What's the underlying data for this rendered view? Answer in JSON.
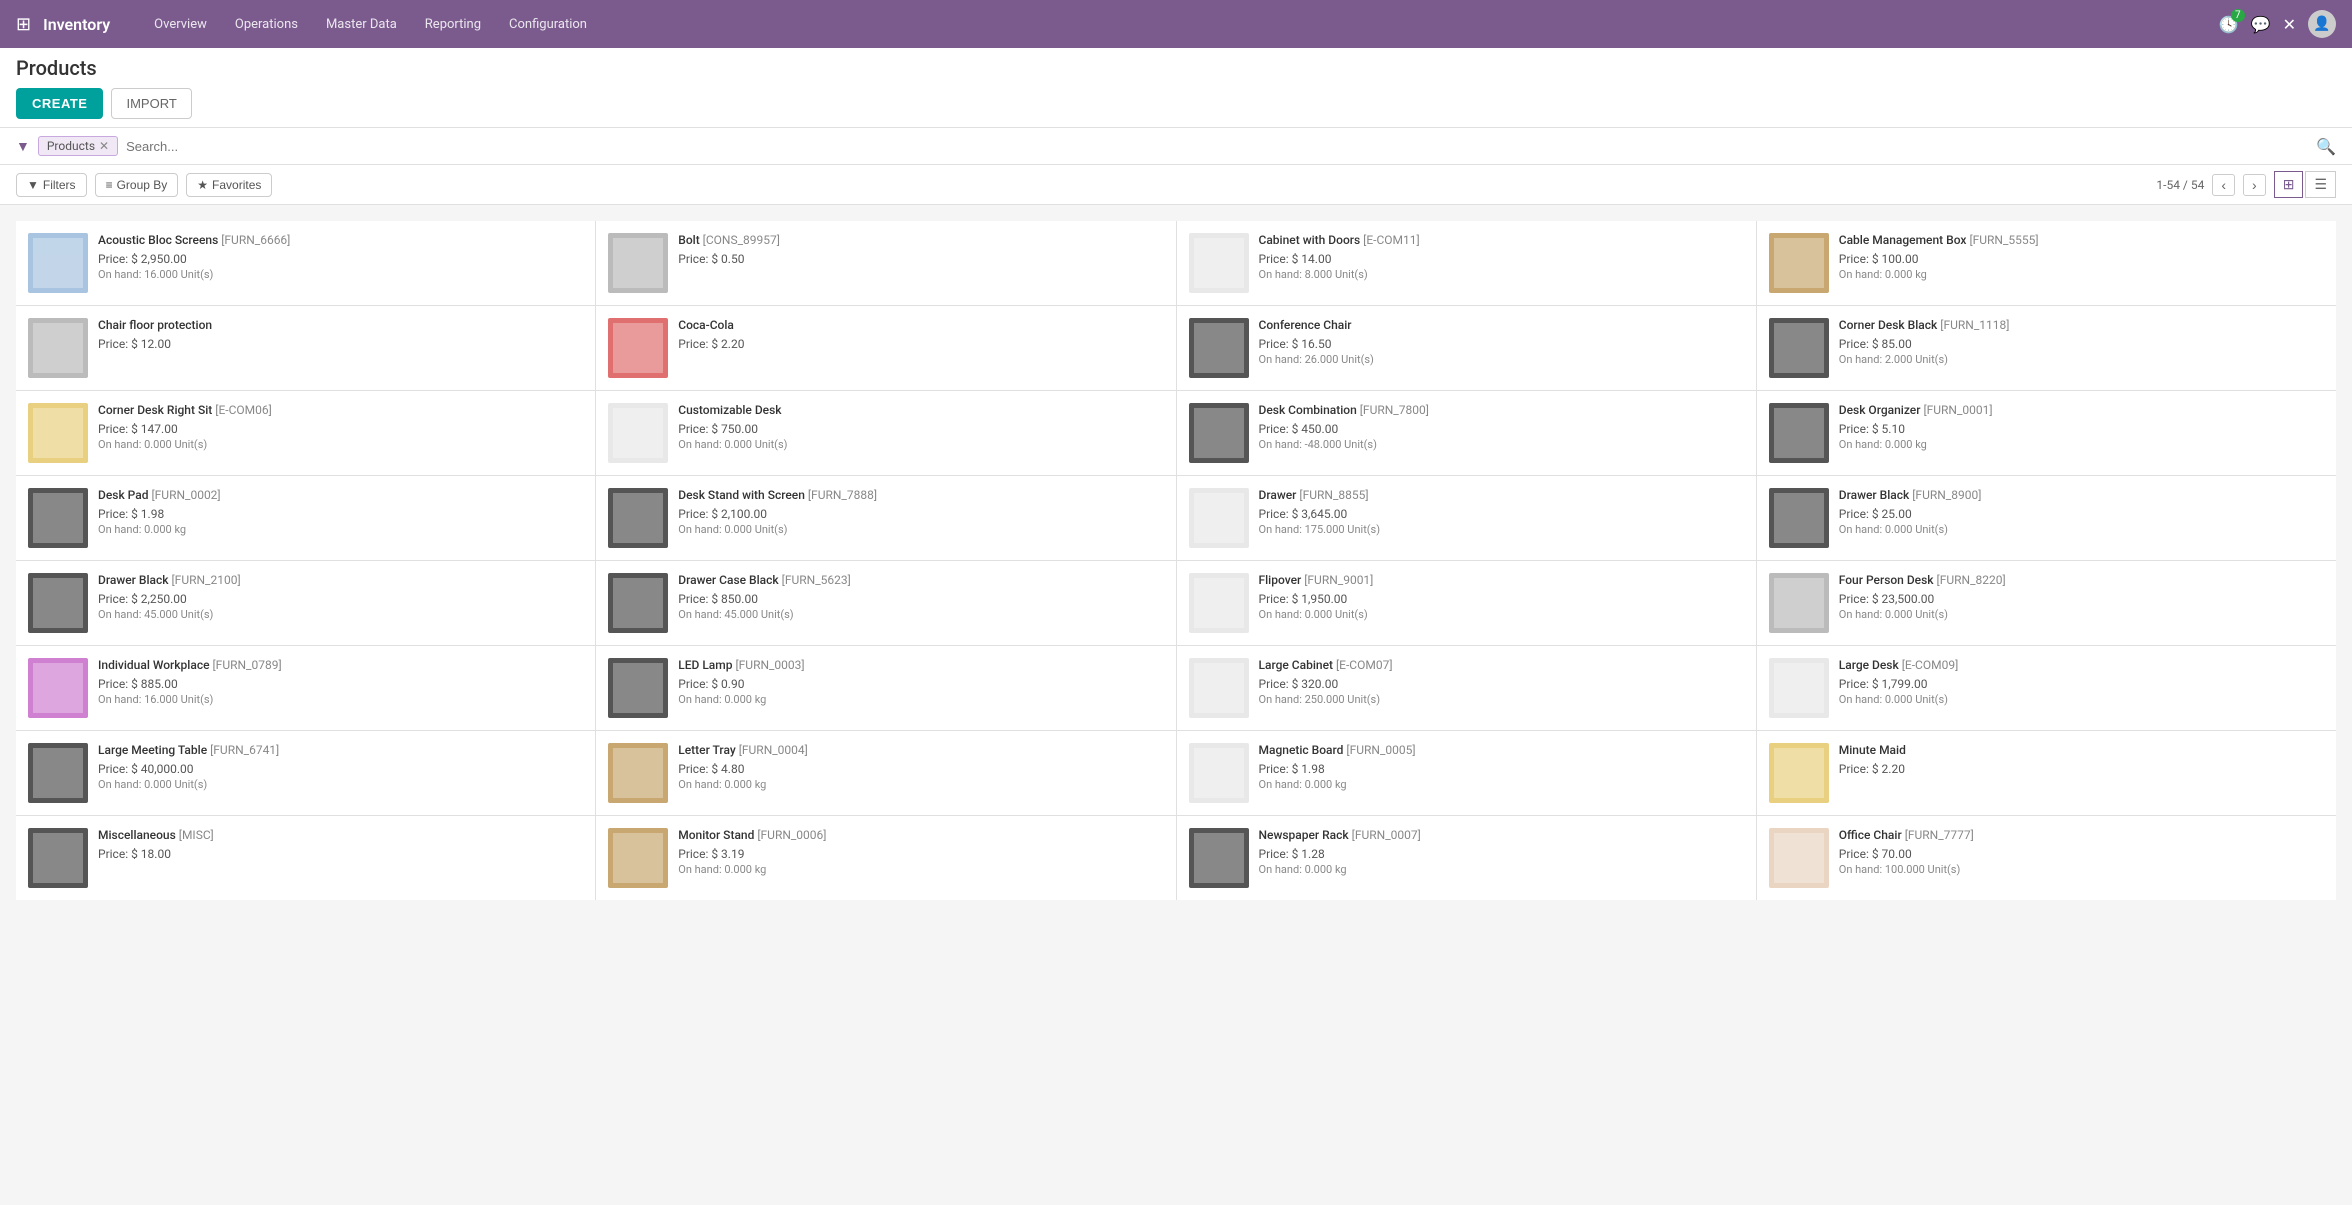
{
  "app": {
    "name": "Inventory",
    "nav_links": [
      "Overview",
      "Operations",
      "Master Data",
      "Reporting",
      "Configuration"
    ]
  },
  "page": {
    "title": "Products",
    "create_label": "CREATE",
    "import_label": "IMPORT"
  },
  "search": {
    "tag": "Products",
    "placeholder": "Search...",
    "filter_label": "Filters",
    "group_label": "Group By",
    "favorites_label": "Favorites"
  },
  "toolbar": {
    "page_info": "1-54 / 54"
  },
  "products": [
    {
      "name": "Acoustic Bloc Screens",
      "code": "[FURN_6666]",
      "price": "Price: $ 2,950.00",
      "stock": "On hand: 16.000 Unit(s)",
      "color": "blue"
    },
    {
      "name": "Bolt",
      "code": "[CONS_89957]",
      "price": "Price: $ 0.50",
      "stock": "",
      "color": "gray"
    },
    {
      "name": "Cabinet with Doors",
      "code": "[E-COM11]",
      "price": "Price: $ 14.00",
      "stock": "On hand: 8.000 Unit(s)",
      "color": "white"
    },
    {
      "name": "Cable Management Box",
      "code": "[FURN_5555]",
      "price": "Price: $ 100.00",
      "stock": "On hand: 0.000 kg",
      "color": "wood"
    },
    {
      "name": "Chair floor protection",
      "code": "",
      "price": "Price: $ 12.00",
      "stock": "",
      "color": "gray"
    },
    {
      "name": "Coca-Cola",
      "code": "",
      "price": "Price: $ 2.20",
      "stock": "",
      "color": "red"
    },
    {
      "name": "Conference Chair",
      "code": "",
      "price": "Price: $ 16.50",
      "stock": "On hand: 26.000 Unit(s)",
      "color": "dark"
    },
    {
      "name": "Corner Desk Black",
      "code": "[FURN_1118]",
      "price": "Price: $ 85.00",
      "stock": "On hand: 2.000 Unit(s)",
      "color": "dark"
    },
    {
      "name": "Corner Desk Right Sit",
      "code": "[E-COM06]",
      "price": "Price: $ 147.00",
      "stock": "On hand: 0.000 Unit(s)",
      "color": "yellow"
    },
    {
      "name": "Customizable Desk",
      "code": "",
      "price": "Price: $ 750.00",
      "stock": "On hand: 0.000 Unit(s)",
      "color": "white"
    },
    {
      "name": "Desk Combination",
      "code": "[FURN_7800]",
      "price": "Price: $ 450.00",
      "stock": "On hand: -48.000 Unit(s)",
      "color": "dark"
    },
    {
      "name": "Desk Organizer",
      "code": "[FURN_0001]",
      "price": "Price: $ 5.10",
      "stock": "On hand: 0.000 kg",
      "color": "dark"
    },
    {
      "name": "Desk Pad",
      "code": "[FURN_0002]",
      "price": "Price: $ 1.98",
      "stock": "On hand: 0.000 kg",
      "color": "dark"
    },
    {
      "name": "Desk Stand with Screen",
      "code": "[FURN_7888]",
      "price": "Price: $ 2,100.00",
      "stock": "On hand: 0.000 Unit(s)",
      "color": "dark"
    },
    {
      "name": "Drawer",
      "code": "[FURN_8855]",
      "price": "Price: $ 3,645.00",
      "stock": "On hand: 175.000 Unit(s)",
      "color": "white"
    },
    {
      "name": "Drawer Black",
      "code": "[FURN_8900]",
      "price": "Price: $ 25.00",
      "stock": "On hand: 0.000 Unit(s)",
      "color": "dark"
    },
    {
      "name": "Drawer Black",
      "code": "[FURN_2100]",
      "price": "Price: $ 2,250.00",
      "stock": "On hand: 45.000 Unit(s)",
      "color": "dark"
    },
    {
      "name": "Drawer Case Black",
      "code": "[FURN_5623]",
      "price": "Price: $ 850.00",
      "stock": "On hand: 45.000 Unit(s)",
      "color": "dark"
    },
    {
      "name": "Flipover",
      "code": "[FURN_9001]",
      "price": "Price: $ 1,950.00",
      "stock": "On hand: 0.000 Unit(s)",
      "color": "white"
    },
    {
      "name": "Four Person Desk",
      "code": "[FURN_8220]",
      "price": "Price: $ 23,500.00",
      "stock": "On hand: 0.000 Unit(s)",
      "color": "gray"
    },
    {
      "name": "Individual Workplace",
      "code": "[FURN_0789]",
      "price": "Price: $ 885.00",
      "stock": "On hand: 16.000 Unit(s)",
      "color": "purple"
    },
    {
      "name": "LED Lamp",
      "code": "[FURN_0003]",
      "price": "Price: $ 0.90",
      "stock": "On hand: 0.000 kg",
      "color": "dark"
    },
    {
      "name": "Large Cabinet",
      "code": "[E-COM07]",
      "price": "Price: $ 320.00",
      "stock": "On hand: 250.000 Unit(s)",
      "color": "white"
    },
    {
      "name": "Large Desk",
      "code": "[E-COM09]",
      "price": "Price: $ 1,799.00",
      "stock": "On hand: 0.000 Unit(s)",
      "color": "white"
    },
    {
      "name": "Large Meeting Table",
      "code": "[FURN_6741]",
      "price": "Price: $ 40,000.00",
      "stock": "On hand: 0.000 Unit(s)",
      "color": "dark"
    },
    {
      "name": "Letter Tray",
      "code": "[FURN_0004]",
      "price": "Price: $ 4.80",
      "stock": "On hand: 0.000 kg",
      "color": "wood"
    },
    {
      "name": "Magnetic Board",
      "code": "[FURN_0005]",
      "price": "Price: $ 1.98",
      "stock": "On hand: 0.000 kg",
      "color": "white"
    },
    {
      "name": "Minute Maid",
      "code": "",
      "price": "Price: $ 2.20",
      "stock": "",
      "color": "yellow"
    },
    {
      "name": "Miscellaneous",
      "code": "[MISC]",
      "price": "Price: $ 18.00",
      "stock": "",
      "color": "dark"
    },
    {
      "name": "Monitor Stand",
      "code": "[FURN_0006]",
      "price": "Price: $ 3.19",
      "stock": "On hand: 0.000 kg",
      "color": "wood"
    },
    {
      "name": "Newspaper Rack",
      "code": "[FURN_0007]",
      "price": "Price: $ 1.28",
      "stock": "On hand: 0.000 kg",
      "color": "dark"
    },
    {
      "name": "Office Chair",
      "code": "[FURN_7777]",
      "price": "Price: $ 70.00",
      "stock": "On hand: 100.000 Unit(s)",
      "color": "brown"
    }
  ]
}
